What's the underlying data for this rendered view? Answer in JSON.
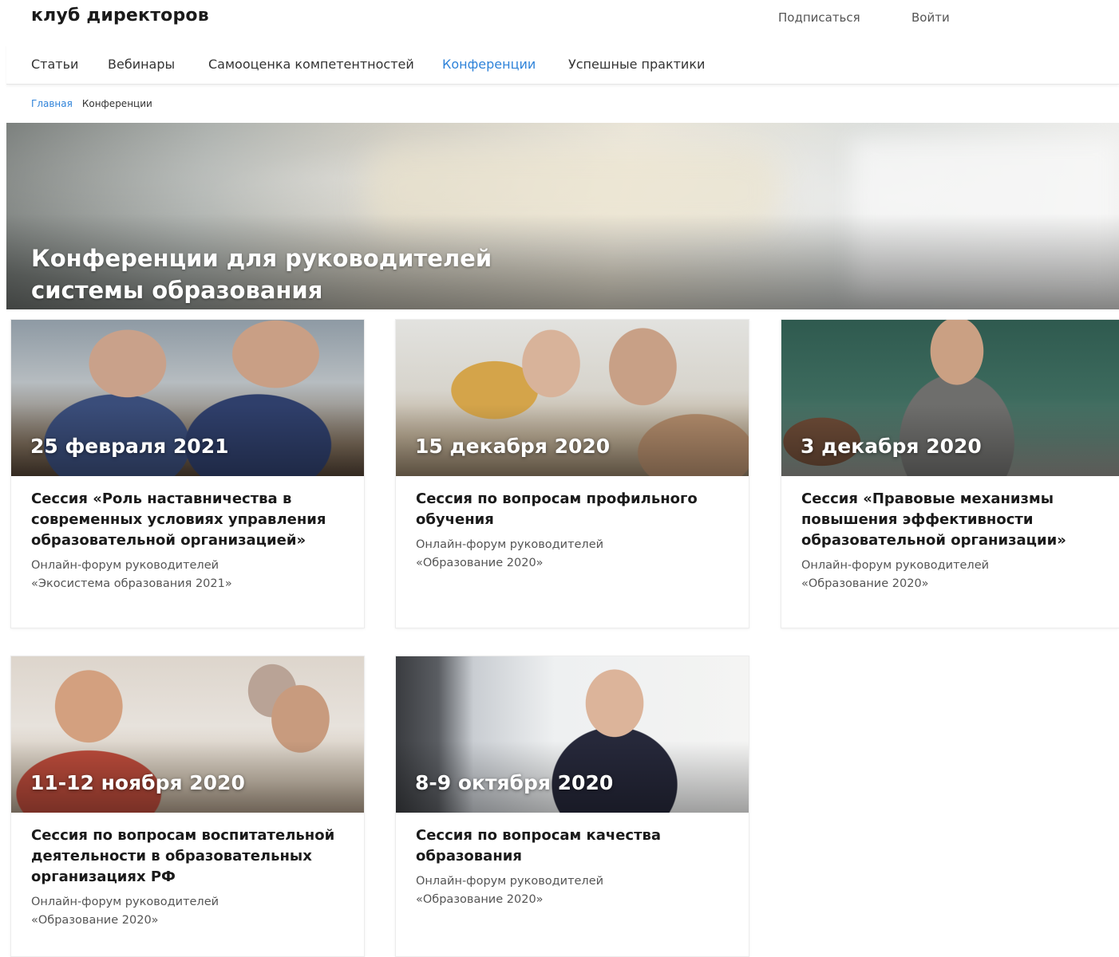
{
  "header": {
    "logo": "клуб директоров",
    "subscribe": "Подписаться",
    "login": "Войти"
  },
  "nav": {
    "items": [
      {
        "label": "Статьи"
      },
      {
        "label": "Вебинары"
      },
      {
        "label": "Самооценка компетентностей"
      },
      {
        "label": "Конференции"
      },
      {
        "label": "Успешные практики"
      }
    ],
    "active": "Конференции"
  },
  "breadcrumb": {
    "home": "Главная",
    "current": "Конференции"
  },
  "hero": {
    "title_line1": "Конференции для руководителей",
    "title_line2": "системы образования"
  },
  "cards": [
    {
      "date": "25 февраля 2021",
      "title": "Сессия «Роль наставничества в современных условиях управления образовательной организацией»",
      "subtitle_line1": "Онлайн-форум руководителей",
      "subtitle_line2": "«Экосистема образования 2021»"
    },
    {
      "date": "15 декабря 2020",
      "title": "Сессия по вопросам профильного обучения",
      "subtitle_line1": "Онлайн-форум руководителей",
      "subtitle_line2": "«Образование 2020»"
    },
    {
      "date": "3 декабря 2020",
      "title": "Сессия «Правовые механизмы повышения эффективности образовательной организации»",
      "subtitle_line1": "Онлайн-форум руководителей",
      "subtitle_line2": "«Образование 2020»"
    },
    {
      "date": "11-12 ноября 2020",
      "title": "Сессия по вопросам воспитательной деятельности в образовательных организациях РФ",
      "subtitle_line1": "Онлайн-форум руководителей",
      "subtitle_line2": "«Образование 2020»"
    },
    {
      "date": "8-9 октября 2020",
      "title": "Сессия по вопросам качества образования",
      "subtitle_line1": "Онлайн-форум руководителей",
      "subtitle_line2": "«Образование 2020»"
    }
  ],
  "colors": {
    "accent": "#2f83d9",
    "text": "#1a1a1a",
    "muted": "#555555"
  }
}
